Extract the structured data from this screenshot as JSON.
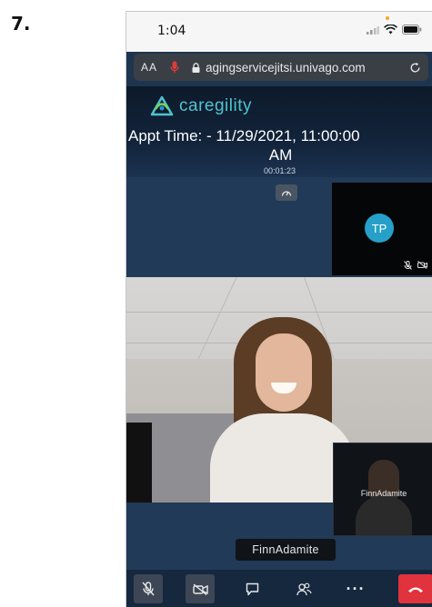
{
  "step_label": "7.",
  "status_bar": {
    "time": "1:04"
  },
  "url_bar": {
    "text_size": "AA",
    "url": "agingservicejitsi.univago.com"
  },
  "logo": {
    "text": "caregility"
  },
  "appointment": {
    "line1": "Appt Time:  - 11/29/2021, 11:00:00",
    "line2": "AM"
  },
  "timer": "00:01:23",
  "remote_participant": {
    "initials": "TP"
  },
  "self_view": {
    "name": "FinnAdamite"
  },
  "speaker_tag": {
    "name": "FinnAdamite"
  },
  "toolbar": {
    "more_label": "···"
  },
  "colors": {
    "accent": "#26a0c8",
    "hangup": "#e0333d",
    "logo": "#4fc3cf"
  }
}
